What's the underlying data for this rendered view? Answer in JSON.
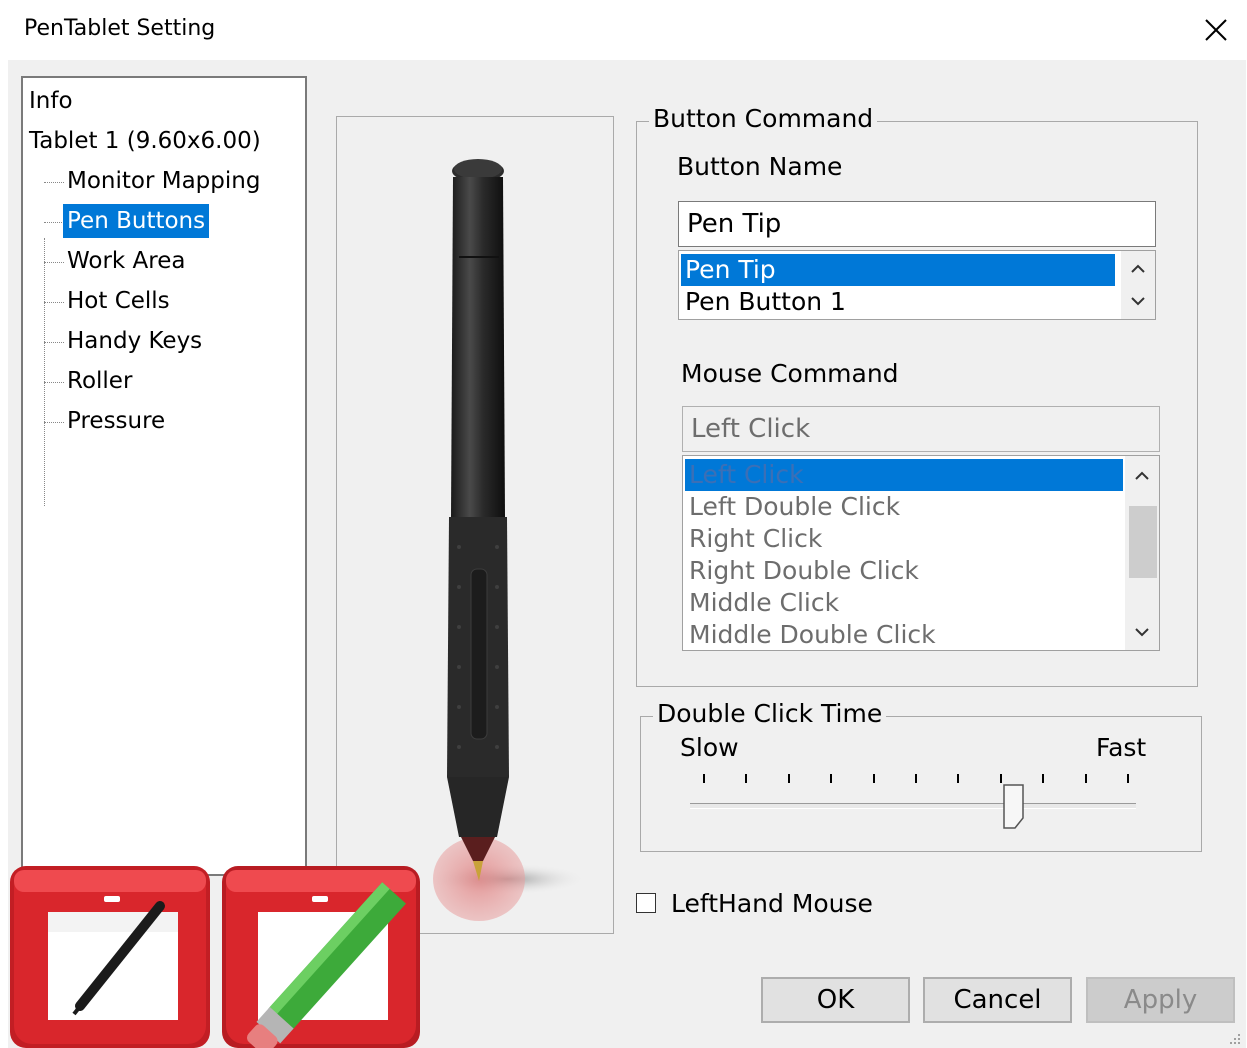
{
  "window": {
    "title": "PenTablet Setting",
    "close_glyph": "✕"
  },
  "tree": {
    "items": [
      {
        "label": "Info",
        "level": 0,
        "selected": false
      },
      {
        "label": "Tablet  1 (9.60x6.00)",
        "level": 0,
        "selected": false
      },
      {
        "label": "Monitor Mapping",
        "level": 1,
        "selected": false
      },
      {
        "label": "Pen Buttons",
        "level": 1,
        "selected": true
      },
      {
        "label": "Work Area",
        "level": 1,
        "selected": false
      },
      {
        "label": "Hot Cells",
        "level": 1,
        "selected": false
      },
      {
        "label": "Handy Keys",
        "level": 1,
        "selected": false
      },
      {
        "label": "Roller",
        "level": 1,
        "selected": false
      },
      {
        "label": "Pressure",
        "level": 1,
        "selected": false
      }
    ]
  },
  "button_command": {
    "group_title": "Button Command",
    "button_name_label": "Button Name",
    "button_name_value": "Pen Tip",
    "button_list": [
      "Pen Tip",
      "Pen Button 1"
    ],
    "button_list_selected": "Pen Tip"
  },
  "mouse_command": {
    "label": "Mouse Command",
    "value": "Left Click",
    "options": [
      "Left Click",
      "Left Double Click",
      "Right Click",
      "Right Double Click",
      "Middle Click",
      "Middle Double Click"
    ],
    "selected": "Left Click",
    "enabled": false
  },
  "double_click": {
    "group_title": "Double Click Time",
    "slow_label": "Slow",
    "fast_label": "Fast",
    "tick_count": 11,
    "slider_fraction": 0.73
  },
  "lefthand": {
    "label": "LeftHand Mouse",
    "checked": false
  },
  "buttons": {
    "ok": "OK",
    "cancel": "Cancel",
    "apply": "Apply",
    "apply_enabled": false
  },
  "colors": {
    "selection": "#0078d7",
    "icon_red": "#d9262c",
    "pencil_green": "#3daa3a"
  },
  "icons": [
    "close-icon",
    "pen-image",
    "scroll-up-icon",
    "scroll-down-icon",
    "tablet-pen-app-icon",
    "tablet-pencil-app-icon",
    "slider-thumb",
    "size-grip-icon"
  ]
}
